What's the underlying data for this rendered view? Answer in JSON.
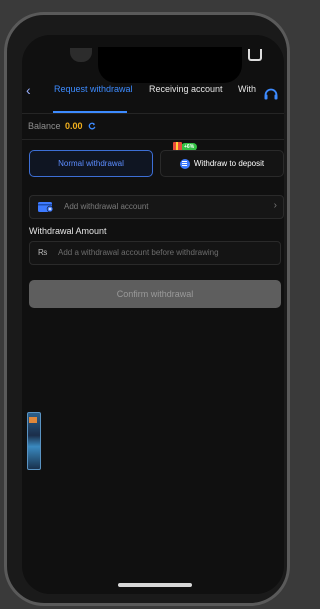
{
  "nav": {
    "back_icon": "chevron-left-icon",
    "tabs": [
      {
        "label": "Request withdrawal",
        "active": true
      },
      {
        "label": "Receiving account",
        "active": false
      },
      {
        "label": "With",
        "active": false
      }
    ],
    "support_icon": "headset-icon"
  },
  "balance": {
    "label": "Balance",
    "amount": "0.00",
    "refresh_icon": "refresh-icon"
  },
  "methods": {
    "normal": {
      "label": "Normal withdrawal",
      "selected": true
    },
    "deposit": {
      "label": "Withdraw to deposit",
      "bonus": "+6%",
      "icon": "deposit-icon"
    }
  },
  "account": {
    "placeholder": "Add withdrawal account",
    "icon": "wallet-add-icon"
  },
  "amount": {
    "label": "Withdrawal Amount",
    "currency": "₨",
    "placeholder": "Add a withdrawal account before withdrawing"
  },
  "confirm": {
    "label": "Confirm withdrawal"
  },
  "colors": {
    "accent": "#3d8bff",
    "balance": "#f2b01e",
    "bonus": "#32c043"
  }
}
